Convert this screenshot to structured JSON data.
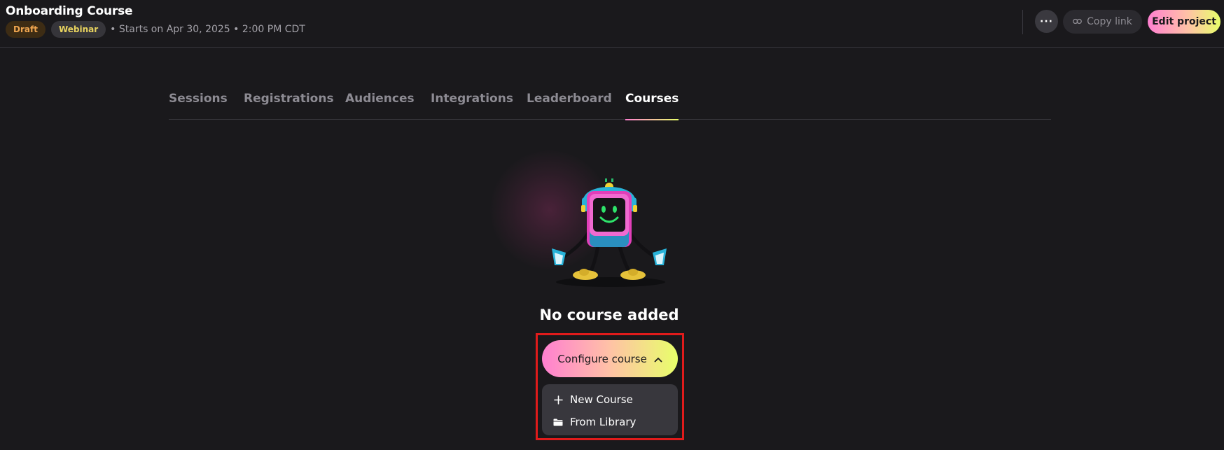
{
  "header": {
    "title": "Onboarding Course",
    "badges": {
      "status": "Draft",
      "type": "Webinar"
    },
    "start_text": "• Starts on Apr 30, 2025 • 2:00 PM CDT",
    "more_label": "···",
    "copy_link_label": "Copy link",
    "edit_project_label": "Edit project"
  },
  "tabs": [
    {
      "label": "Sessions",
      "active": false
    },
    {
      "label": "Registrations",
      "active": false
    },
    {
      "label": "Audiences",
      "active": false
    },
    {
      "label": "Integrations",
      "active": false
    },
    {
      "label": "Leaderboard",
      "active": false
    },
    {
      "label": "Courses",
      "active": true
    }
  ],
  "empty_state": {
    "title": "No course added",
    "configure_label": "Configure course",
    "menu": [
      {
        "label": "New Course",
        "icon": "plus-icon"
      },
      {
        "label": "From Library",
        "icon": "folder-icon"
      }
    ]
  },
  "colors": {
    "background": "#1a191c",
    "accent_gradient_start": "#ff7fd0",
    "accent_gradient_end": "#e8ff6a",
    "highlight": "#e01b1b"
  }
}
